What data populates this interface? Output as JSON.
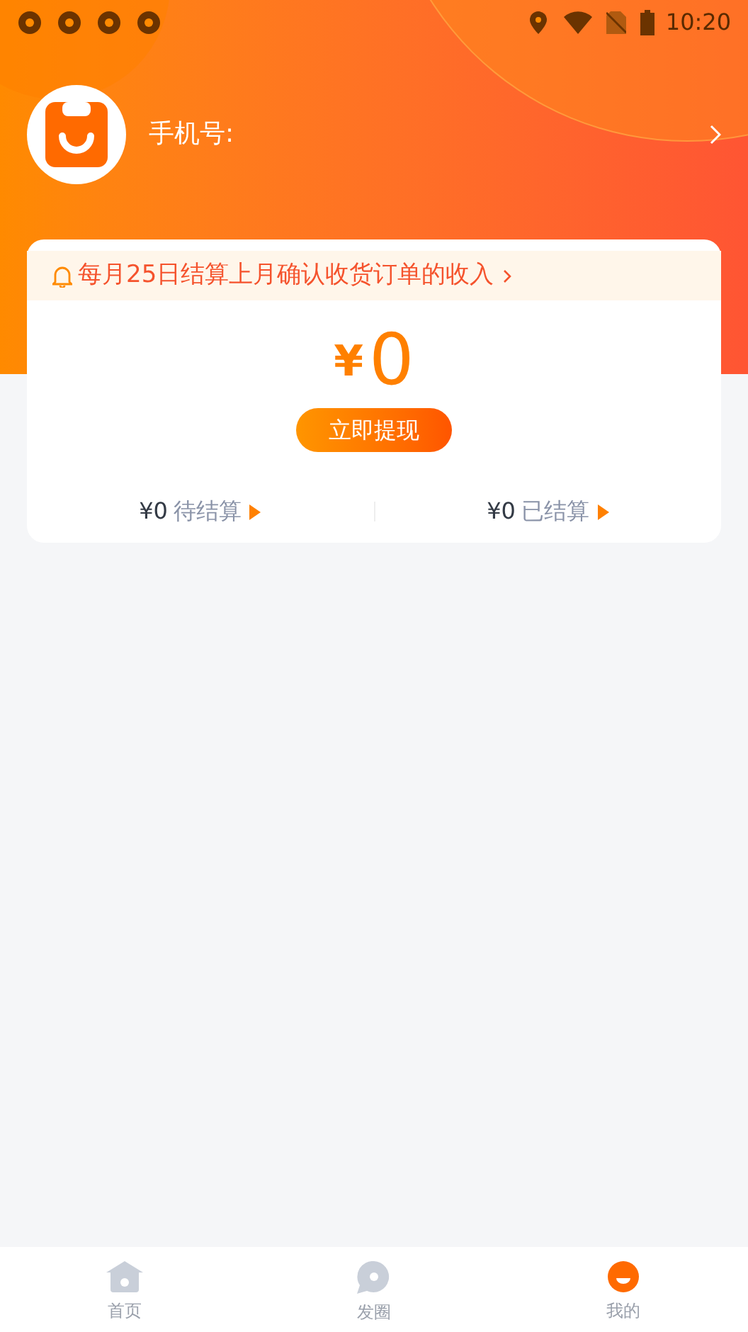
{
  "status_bar": {
    "time": "10:20"
  },
  "profile": {
    "label": "手机号:"
  },
  "notice": {
    "text": "每月25日结算上月确认收货订单的收入"
  },
  "balance": {
    "currency": "¥",
    "amount": "0",
    "button": "立即提现"
  },
  "settlements": [
    {
      "amount": "¥0",
      "label": "待结算"
    },
    {
      "amount": "¥0",
      "label": "已结算"
    }
  ],
  "tab_bar": [
    {
      "label": "首页",
      "selected": false
    },
    {
      "label": "发圈",
      "selected": false
    },
    {
      "label": "我的",
      "selected": true
    }
  ]
}
